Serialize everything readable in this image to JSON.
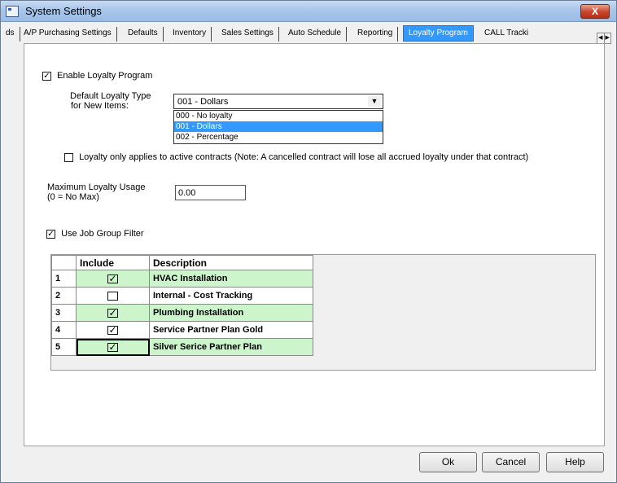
{
  "window": {
    "title": "System Settings",
    "close_label": "X"
  },
  "tabs": [
    {
      "label": "ds"
    },
    {
      "label": "A/P Purchasing Settings"
    },
    {
      "label": "Defaults"
    },
    {
      "label": "Inventory"
    },
    {
      "label": "Sales Settings"
    },
    {
      "label": "Auto Schedule"
    },
    {
      "label": "Reporting"
    },
    {
      "label": "Loyalty Program",
      "active": true
    },
    {
      "label": "CALL Tracki"
    }
  ],
  "loyalty": {
    "enable_label": "Enable Loyalty Program",
    "enable_checked": true,
    "default_type_label_line1": "Default Loyalty Type",
    "default_type_label_line2": "for New Items:",
    "default_type_value": "001 - Dollars",
    "options": [
      "000 - No loyalty",
      "001 - Dollars",
      "002 - Percentage"
    ],
    "selected_option_index": 1,
    "active_contracts_label": "Loyalty only applies to active contracts (Note: A cancelled contract will lose all accrued loyalty under that contract)",
    "active_contracts_checked": false,
    "max_usage_label_line1": "Maximum Loyalty Usage",
    "max_usage_label_line2": "(0 = No Max)",
    "max_usage_value": "0.00",
    "job_group_label": "Use Job Group Filter",
    "job_group_checked": true
  },
  "grid": {
    "headers": {
      "num": "",
      "include": "Include",
      "description": "Description"
    },
    "rows": [
      {
        "num": "1",
        "include": true,
        "description": "HVAC Installation"
      },
      {
        "num": "2",
        "include": false,
        "description": "Internal - Cost Tracking"
      },
      {
        "num": "3",
        "include": true,
        "description": "Plumbing Installation"
      },
      {
        "num": "4",
        "include": true,
        "description": "Service Partner Plan Gold"
      },
      {
        "num": "5",
        "include": true,
        "description": "Silver Serice Partner Plan"
      }
    ]
  },
  "buttons": {
    "ok": "Ok",
    "cancel": "Cancel",
    "help": "Help"
  },
  "colors": {
    "included_row": "#ccf5cc",
    "selection": "#3399ff",
    "close_button": "#c8432b"
  }
}
